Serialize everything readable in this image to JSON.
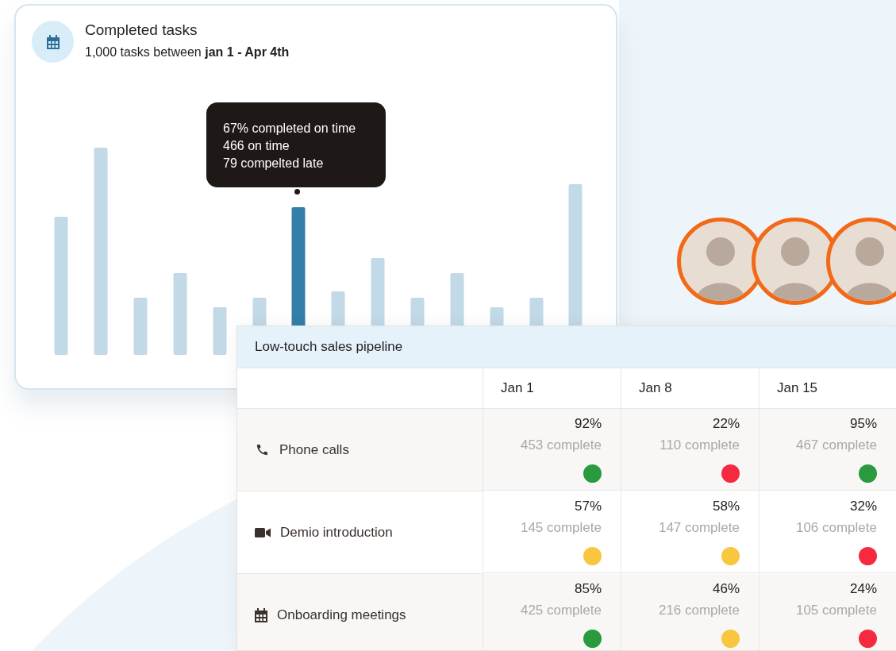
{
  "chart_card": {
    "title": "Completed tasks",
    "subtitle": "1,000 tasks between **jan 1 - Apr 4th**",
    "tooltip": [
      "67% completed on time",
      "466 on time",
      "79 compelted late"
    ]
  },
  "pipeline": {
    "title": "Low-touch sales pipeline",
    "columns": [
      "Jan 1",
      "Jan 8",
      "Jan 15"
    ],
    "rows": [
      {
        "kind": "phone",
        "label": "Phone calls",
        "cells": [
          {
            "percent": "92%",
            "complete": "453 complete",
            "color": "#2a9a3e"
          },
          {
            "percent": "22%",
            "complete": "110 complete",
            "color": "#f5293f"
          },
          {
            "percent": "95%",
            "complete": "467 complete",
            "color": "#2a9a3e"
          }
        ]
      },
      {
        "kind": "video",
        "label": "Demio introduction",
        "cells": [
          {
            "percent": "57%",
            "complete": "145 complete",
            "color": "#f8c63f"
          },
          {
            "percent": "58%",
            "complete": "147 complete",
            "color": "#f8c63f"
          },
          {
            "percent": "32%",
            "complete": "106 complete",
            "color": "#f5293f"
          }
        ]
      },
      {
        "kind": "calendar",
        "label": "Onboarding meetings",
        "cells": [
          {
            "percent": "85%",
            "complete": "425 complete",
            "color": "#2a9a3e"
          },
          {
            "percent": "46%",
            "complete": "216 complete",
            "color": "#f8c63f"
          },
          {
            "percent": "24%",
            "complete": "105 complete",
            "color": "#f5293f"
          }
        ]
      }
    ]
  }
}
